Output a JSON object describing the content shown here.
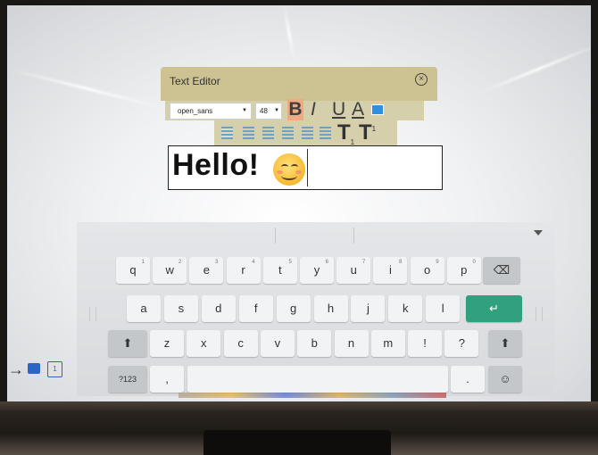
{
  "editor": {
    "title": "Text Editor",
    "font": "open_sans",
    "size": "48",
    "bold": "B",
    "italic": "I",
    "underline": "U",
    "font_color": "A",
    "subscript_letter": "T",
    "subscript_mark": "1",
    "superscript_letter": "T",
    "superscript_mark": "1",
    "content_text": "Hello!",
    "emoji": "smiling-face"
  },
  "keyboard": {
    "row1": [
      {
        "label": "q",
        "hint": "1"
      },
      {
        "label": "w",
        "hint": "2"
      },
      {
        "label": "e",
        "hint": "3"
      },
      {
        "label": "r",
        "hint": "4"
      },
      {
        "label": "t",
        "hint": "5"
      },
      {
        "label": "y",
        "hint": "6"
      },
      {
        "label": "u",
        "hint": "7"
      },
      {
        "label": "i",
        "hint": "8"
      },
      {
        "label": "o",
        "hint": "9"
      },
      {
        "label": "p",
        "hint": "0"
      }
    ],
    "row2": [
      "a",
      "s",
      "d",
      "f",
      "g",
      "h",
      "j",
      "k",
      "l"
    ],
    "row3": [
      "z",
      "x",
      "c",
      "v",
      "b",
      "n",
      "m",
      "!",
      "?"
    ],
    "symbols_label": "?123",
    "comma_label": ",",
    "period_label": ".",
    "backspace_icon": "backspace-icon",
    "enter_icon": "enter-icon",
    "shift_icon": "shift-icon",
    "emoji_icon": "emoji-icon",
    "accent_color": "#31a07e"
  },
  "side_tools": {
    "page_number": "1"
  }
}
